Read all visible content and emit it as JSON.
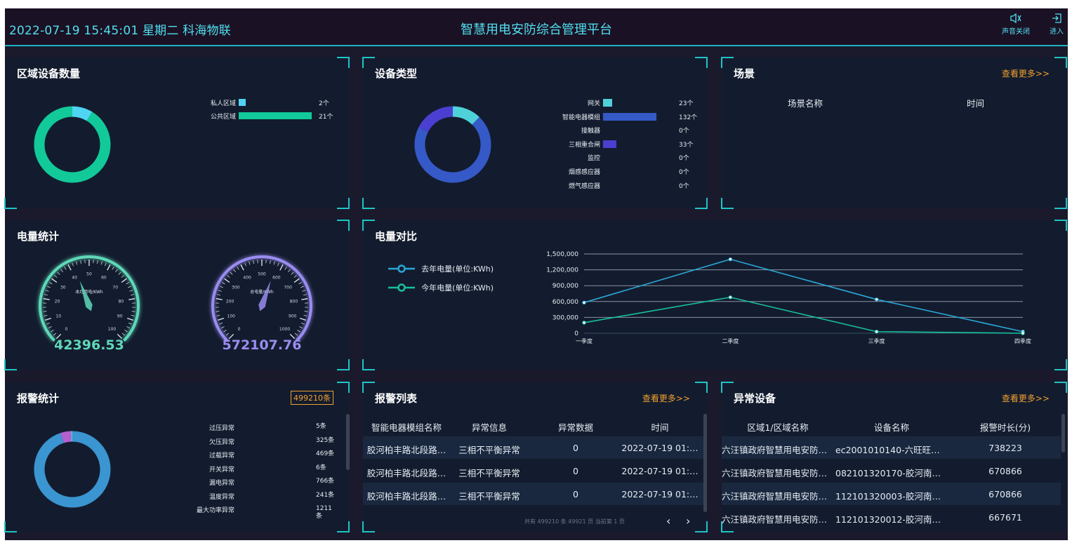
{
  "topbar": {
    "datetime": "2022-07-19 15:45:01 星期二 科海物联",
    "title": "智慧用电安防综合管理平台",
    "sound_label": "声音关闭",
    "enter_label": "进入"
  },
  "region": {
    "title": "区域设备数量",
    "items": [
      {
        "label": "私人区域",
        "value": "2个",
        "num": 2,
        "color": "#4fd5f2"
      },
      {
        "label": "公共区域",
        "value": "21个",
        "num": 21,
        "color": "#12c99a"
      }
    ]
  },
  "device": {
    "title": "设备类型",
    "items": [
      {
        "label": "网关",
        "value": "23个",
        "num": 23,
        "color": "#4fd1d9"
      },
      {
        "label": "智能电器模组",
        "value": "132个",
        "num": 132,
        "color": "#3559c7"
      },
      {
        "label": "接触器",
        "value": "0个",
        "num": 0,
        "color": "#4a4fd6"
      },
      {
        "label": "三相重合闸",
        "value": "33个",
        "num": 33,
        "color": "#4a3fd0"
      },
      {
        "label": "监控",
        "value": "0个",
        "num": 0,
        "color": "#4a4fd6"
      },
      {
        "label": "烟感感应器",
        "value": "0个",
        "num": 0,
        "color": "#4a4fd6"
      },
      {
        "label": "燃气感应器",
        "value": "0个",
        "num": 0,
        "color": "#4a4fd6"
      }
    ]
  },
  "scene": {
    "title": "场景",
    "more": "查看更多>>",
    "col_name": "场景名称",
    "col_time": "时间"
  },
  "power": {
    "title": "电量统计",
    "gauge1": {
      "label": "本月用电/KWh",
      "value": "42396.53",
      "ticks": [
        "0",
        "10",
        "20",
        "30",
        "40",
        "50",
        "60",
        "70",
        "80",
        "90",
        "100"
      ],
      "pointer": 42.4,
      "color": "#5fd8b8"
    },
    "gauge2": {
      "label": "总电量/KWh",
      "value": "572107.76",
      "ticks": [
        "0",
        "100",
        "200",
        "300",
        "400",
        "500",
        "600",
        "700",
        "800",
        "900",
        "1000"
      ],
      "pointer": 572.1,
      "color": "#9a8cf0"
    }
  },
  "compare": {
    "title": "电量对比",
    "legend": [
      "去年电量(单位:KWh)",
      "今年电量(单位:KWh)"
    ]
  },
  "chart_data": {
    "type": "line",
    "categories": [
      "一季度",
      "二季度",
      "三季度",
      "四季度"
    ],
    "y_ticks": [
      "1,500,000",
      "1,200,000",
      "900,000",
      "600,000",
      "300,000",
      "0"
    ],
    "ylim": [
      0,
      1500000
    ],
    "grid": true,
    "legend_position": "left",
    "series": [
      {
        "name": "去年电量(单位:KWh)",
        "values": [
          580000,
          1400000,
          640000,
          30000
        ],
        "color": "#2aa7d6"
      },
      {
        "name": "今年电量(单位:KWh)",
        "values": [
          200000,
          680000,
          30000,
          0
        ],
        "color": "#17c0a0"
      }
    ]
  },
  "alarm_stat": {
    "title": "报警统计",
    "total": "499210条",
    "items": [
      {
        "label": "过压异常",
        "value": "5条",
        "num": 5,
        "color": "#a35ad6"
      },
      {
        "label": "欠压异常",
        "value": "325条",
        "num": 325,
        "color": "#b05fd0"
      },
      {
        "label": "过载异常",
        "value": "469条",
        "num": 469,
        "color": "#c060d0"
      },
      {
        "label": "开关异常",
        "value": "6条",
        "num": 6,
        "color": "#7c7fd6"
      },
      {
        "label": "漏电异常",
        "value": "766条",
        "num": 766,
        "color": "#5aa0d6"
      },
      {
        "label": "温度异常",
        "value": "241条",
        "num": 241,
        "color": "#6fb6d9"
      },
      {
        "label": "最大功率异常",
        "value": "1211条",
        "num": 1211,
        "color": "#3a95d0"
      }
    ],
    "major": {
      "label": "",
      "num": 496187,
      "color": "#3a95d0"
    },
    "minor": {
      "num": 23000,
      "color": "#b45fd0"
    }
  },
  "alarm_list": {
    "title": "报警列表",
    "more": "查看更多>>",
    "headers": [
      "智能电器模组名称",
      "异常信息",
      "异常数据",
      "时间"
    ],
    "rows": [
      [
        "胶河柏丰路北段路…",
        "三相不平衡异常",
        "0",
        "2022-07-19 01:…"
      ],
      [
        "胶河柏丰路北段路…",
        "三相不平衡异常",
        "0",
        "2022-07-19 01:…"
      ],
      [
        "胶河柏丰路北段路…",
        "三相不平衡异常",
        "0",
        "2022-07-19 01:…"
      ]
    ],
    "pager": "共有 499210 条 49921 页 当前第 1 页",
    "prev": "‹",
    "next": "›"
  },
  "abnormal": {
    "title": "异常设备",
    "more": "查看更多>>",
    "headers": [
      "区域1/区域名称",
      "设备名称",
      "报警时长(分)"
    ],
    "rows": [
      [
        "六汪镇政府智慧用电安防…",
        "ec2001010140-六旺旺…",
        "738223"
      ],
      [
        "六汪镇政府智慧用电安防…",
        "082101320170-胶河南…",
        "670866"
      ],
      [
        "六汪镇政府智慧用电安防…",
        "112101320003-胶河南…",
        "670866"
      ],
      [
        "六汪镇政府智慧用电安防…",
        "112101320012-胶河南…",
        "667671"
      ]
    ]
  }
}
